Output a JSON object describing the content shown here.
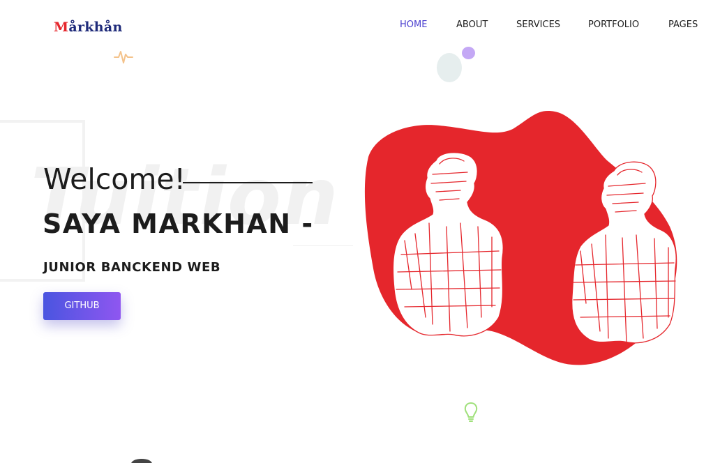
{
  "logo": {
    "first_letter": "M",
    "rest": "årkhån"
  },
  "nav": [
    {
      "label": "HOME",
      "active": true
    },
    {
      "label": "ABOUT",
      "active": false
    },
    {
      "label": "SERVICES",
      "active": false
    },
    {
      "label": "PORTFOLIO",
      "active": false
    },
    {
      "label": "PAGES",
      "active": false
    }
  ],
  "hero": {
    "background_word": "Tuition",
    "welcome": "Welcome!",
    "name": "SAYA MARKHAN -",
    "role": "JUNIOR BANCKEND WEB",
    "button_label": "GITHUB"
  },
  "colors": {
    "accent": "#4a3fcf",
    "logo_red": "#e5262c",
    "logo_navy": "#1f2b7a",
    "blob_red": "#e5262c",
    "button_gradient_start": "#4a55e0",
    "button_gradient_end": "#8f56f0"
  },
  "icons": {
    "pulse": "heartbeat-icon",
    "bulb": "lightbulb-icon"
  }
}
